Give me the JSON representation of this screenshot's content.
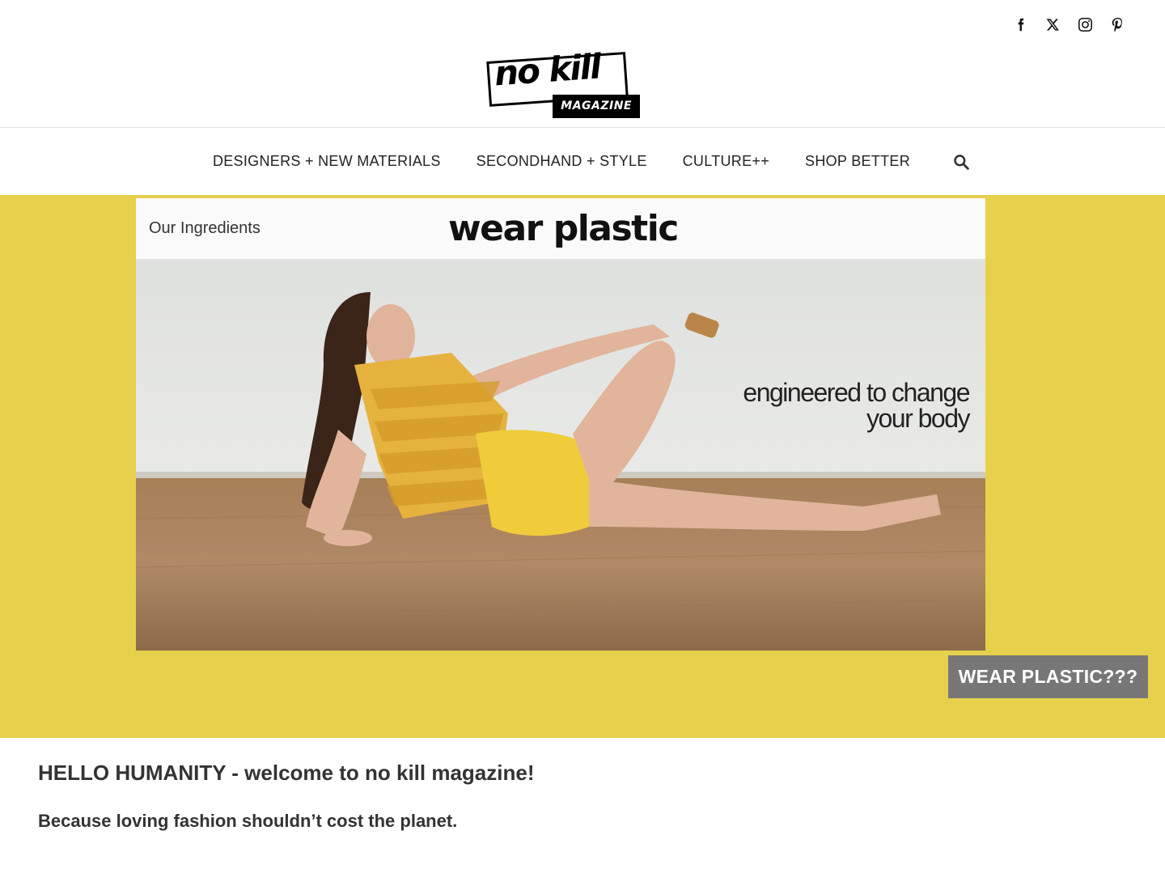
{
  "social": {
    "icons": [
      "facebook-icon",
      "x-icon",
      "instagram-icon",
      "pinterest-icon"
    ]
  },
  "logo": {
    "main": "no kill",
    "sub": "MAGAZINE"
  },
  "nav": {
    "items": [
      {
        "label": "DESIGNERS + NEW MATERIALS"
      },
      {
        "label": "SECONDHAND + STYLE"
      },
      {
        "label": "CULTURE++"
      },
      {
        "label": "SHOP BETTER"
      }
    ],
    "search_icon": "search-icon"
  },
  "hero": {
    "background_color": "#e7d04b",
    "ad": {
      "ingredients_label": "Our Ingredients",
      "brand": "wear plastic",
      "tagline_line1": "engineered to change",
      "tagline_line2": "your body"
    },
    "button_label": "WEAR PLASTIC???"
  },
  "intro": {
    "heading_caps": "HELLO HUMANITY",
    "heading_rest": " - welcome to no kill magazine!",
    "subheading": "Because loving fashion shouldn’t cost the planet."
  }
}
